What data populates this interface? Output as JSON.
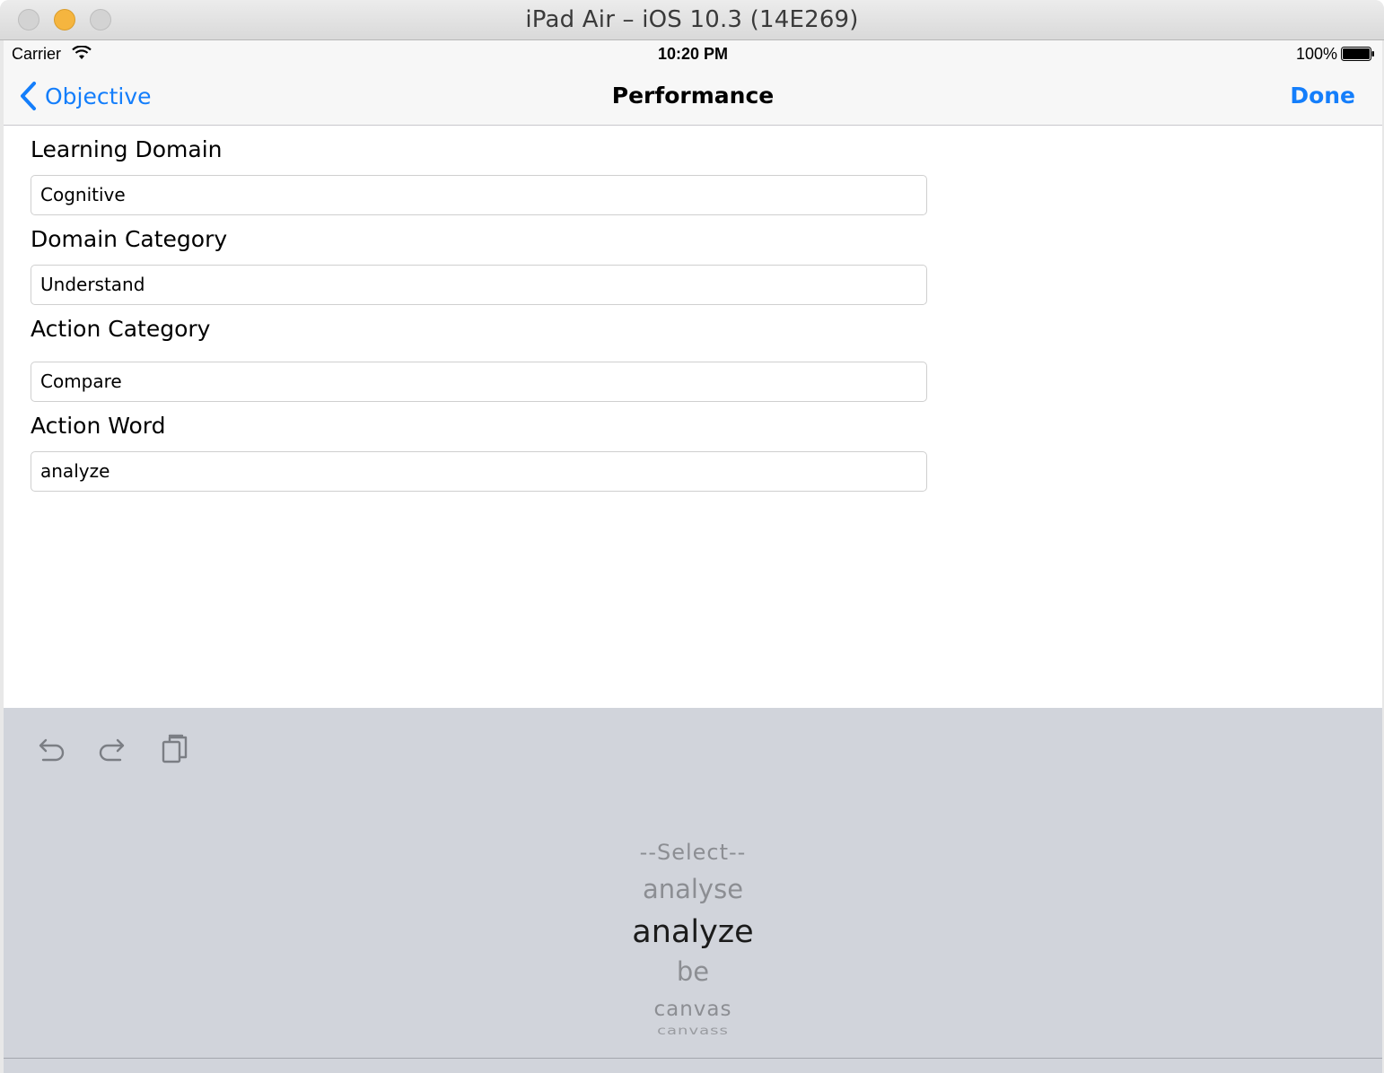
{
  "window": {
    "title": "iPad Air – iOS 10.3 (14E269)"
  },
  "status_bar": {
    "carrier": "Carrier",
    "time": "10:20 PM",
    "battery": "100%"
  },
  "nav_bar": {
    "back_label": "Objective",
    "title": "Performance",
    "done_label": "Done"
  },
  "form": {
    "fields": [
      {
        "label": "Learning Domain",
        "value": "Cognitive"
      },
      {
        "label": "Domain Category",
        "value": "Understand"
      },
      {
        "label": "Action Category",
        "value": "Compare"
      },
      {
        "label": "Action Word",
        "value": "analyze"
      }
    ]
  },
  "picker": {
    "items": [
      "--Select--",
      "analyse",
      "analyze",
      "be",
      "canvas",
      "canvass"
    ],
    "selected": "analyze"
  },
  "colors": {
    "accent": "#147efb",
    "keyboard_background": "#d1d4db",
    "minimize_button": "#f5b53f"
  },
  "icons": {
    "undo": "undo-icon",
    "redo": "redo-icon",
    "paste": "paste-icon"
  }
}
